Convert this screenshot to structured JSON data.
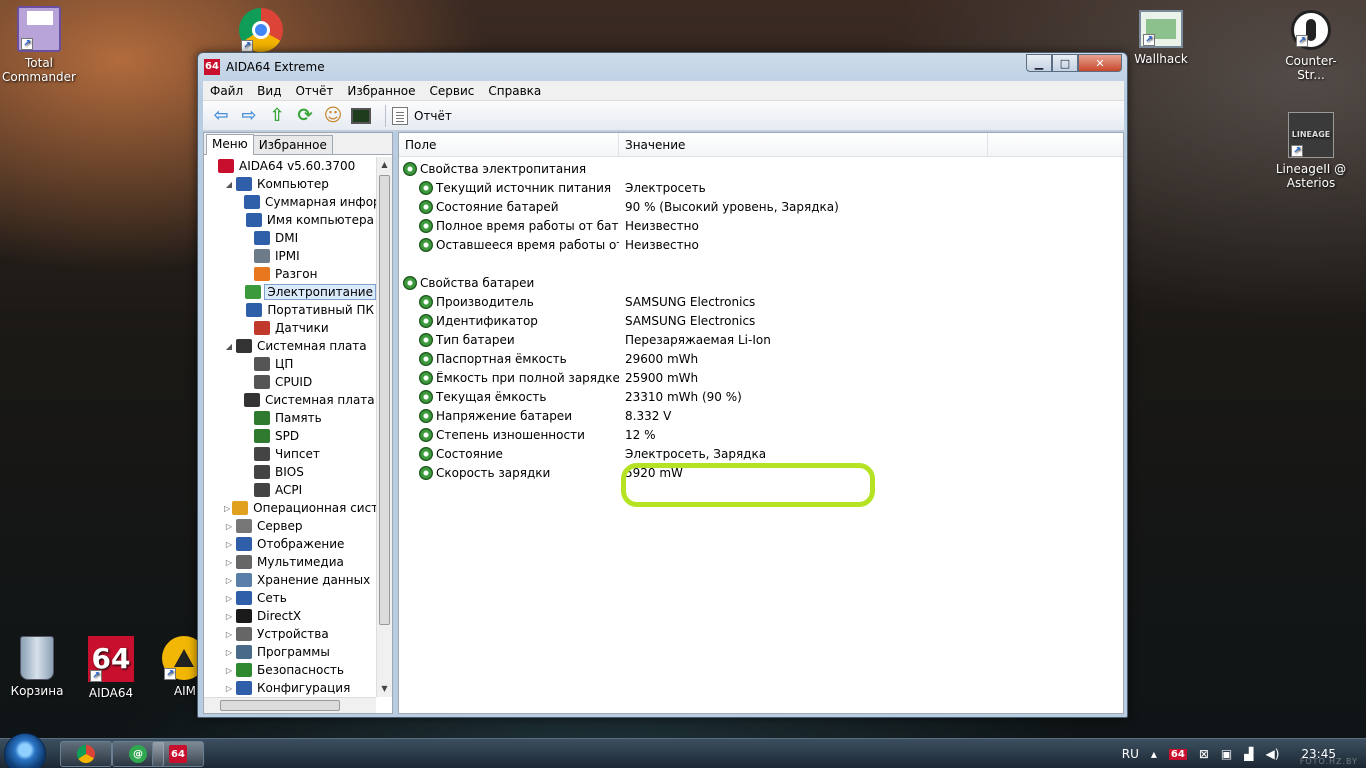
{
  "desktop": {
    "icons": [
      {
        "label": "Total Commander",
        "icon": "floppy-icon"
      },
      {
        "label": "",
        "icon": "chrome-icon"
      },
      {
        "label": "Wallhack",
        "icon": "window-icon"
      },
      {
        "label": "Counter-Str...",
        "icon": "cs-icon"
      },
      {
        "label": "LineageII @ Asterios",
        "icon": "lineage-icon"
      },
      {
        "label": "Корзина",
        "icon": "recycle-bin-icon"
      },
      {
        "label": "AIDA64",
        "icon": "aida64-icon"
      },
      {
        "label": "AIM",
        "icon": "aimp-icon"
      }
    ],
    "aida_logo_text": "64",
    "lineage_logo_text": "LINEAGE"
  },
  "window": {
    "logo": "64",
    "title": "AIDA64 Extreme",
    "min_symbol": "▁",
    "max_symbol": "□",
    "close_symbol": "✕"
  },
  "menu": [
    "Файл",
    "Вид",
    "Отчёт",
    "Избранное",
    "Сервис",
    "Справка"
  ],
  "toolbar": {
    "report_label": "Отчёт",
    "icons": [
      "back-arrow-icon",
      "forward-arrow-icon",
      "up-arrow-icon",
      "refresh-icon",
      "users-icon",
      "monitor-icon"
    ]
  },
  "left_tabs": [
    "Меню",
    "Избранное"
  ],
  "tree": [
    {
      "label": "AIDA64 v5.60.3700",
      "level": 0,
      "exp": "",
      "icon": "aida64-icon",
      "color": "#c8102e"
    },
    {
      "label": "Компьютер",
      "level": 1,
      "exp": "◢",
      "icon": "computer-icon",
      "color": "#2f5fa8"
    },
    {
      "label": "Суммарная инфор",
      "level": 2,
      "exp": "",
      "icon": "computer-icon",
      "color": "#2f5fa8"
    },
    {
      "label": "Имя компьютера",
      "level": 2,
      "exp": "",
      "icon": "computer-icon",
      "color": "#2f5fa8"
    },
    {
      "label": "DMI",
      "level": 2,
      "exp": "",
      "icon": "computer-icon",
      "color": "#2f5fa8"
    },
    {
      "label": "IPMI",
      "level": 2,
      "exp": "",
      "icon": "document-icon",
      "color": "#6c7a8a"
    },
    {
      "label": "Разгон",
      "level": 2,
      "exp": "",
      "icon": "flame-icon",
      "color": "#e8771e"
    },
    {
      "label": "Электропитание",
      "level": 2,
      "exp": "",
      "icon": "power-gear-icon",
      "color": "#3c9a3c",
      "selected": true
    },
    {
      "label": "Портативный ПК",
      "level": 2,
      "exp": "",
      "icon": "laptop-icon",
      "color": "#2f5fa8"
    },
    {
      "label": "Датчики",
      "level": 2,
      "exp": "",
      "icon": "sensor-icon",
      "color": "#c0392b"
    },
    {
      "label": "Системная плата",
      "level": 1,
      "exp": "◢",
      "icon": "motherboard-icon",
      "color": "#333333"
    },
    {
      "label": "ЦП",
      "level": 2,
      "exp": "",
      "icon": "cpu-icon",
      "color": "#555555"
    },
    {
      "label": "CPUID",
      "level": 2,
      "exp": "",
      "icon": "cpu-icon",
      "color": "#555555"
    },
    {
      "label": "Системная плата",
      "level": 2,
      "exp": "",
      "icon": "motherboard-icon",
      "color": "#333333"
    },
    {
      "label": "Память",
      "level": 2,
      "exp": "",
      "icon": "memory-icon",
      "color": "#2f7a2f"
    },
    {
      "label": "SPD",
      "level": 2,
      "exp": "",
      "icon": "memory-icon",
      "color": "#2f7a2f"
    },
    {
      "label": "Чипсет",
      "level": 2,
      "exp": "",
      "icon": "chip-icon",
      "color": "#444444"
    },
    {
      "label": "BIOS",
      "level": 2,
      "exp": "",
      "icon": "chip-icon",
      "color": "#444444"
    },
    {
      "label": "ACPI",
      "level": 2,
      "exp": "",
      "icon": "chip-icon",
      "color": "#444444"
    },
    {
      "label": "Операционная систем",
      "level": 1,
      "exp": "▷",
      "icon": "windows-icon",
      "color": "#e0a020"
    },
    {
      "label": "Сервер",
      "level": 1,
      "exp": "▷",
      "icon": "server-icon",
      "color": "#777777"
    },
    {
      "label": "Отображение",
      "level": 1,
      "exp": "▷",
      "icon": "display-icon",
      "color": "#2f5fa8"
    },
    {
      "label": "Мультимедиа",
      "level": 1,
      "exp": "▷",
      "icon": "multimedia-icon",
      "color": "#666666"
    },
    {
      "label": "Хранение данных",
      "level": 1,
      "exp": "▷",
      "icon": "storage-icon",
      "color": "#5a7fa8"
    },
    {
      "label": "Сеть",
      "level": 1,
      "exp": "▷",
      "icon": "network-icon",
      "color": "#2f5fa8"
    },
    {
      "label": "DirectX",
      "level": 1,
      "exp": "▷",
      "icon": "directx-icon",
      "color": "#1a1a1a"
    },
    {
      "label": "Устройства",
      "level": 1,
      "exp": "▷",
      "icon": "devices-icon",
      "color": "#666666"
    },
    {
      "label": "Программы",
      "level": 1,
      "exp": "▷",
      "icon": "programs-icon",
      "color": "#4a6a8a"
    },
    {
      "label": "Безопасность",
      "level": 1,
      "exp": "▷",
      "icon": "shield-icon",
      "color": "#2f8a2f"
    },
    {
      "label": "Конфигурация",
      "level": 1,
      "exp": "▷",
      "icon": "config-icon",
      "color": "#2f5fa8"
    }
  ],
  "columns": [
    "Поле",
    "Значение"
  ],
  "sections": [
    {
      "title": "Свойства электропитания",
      "rows": [
        {
          "field": "Текущий источник питания",
          "value": "Электросеть"
        },
        {
          "field": "Состояние батарей",
          "value": "90 % (Высокий уровень, Зарядка)"
        },
        {
          "field": "Полное время работы от бата...",
          "value": "Неизвестно"
        },
        {
          "field": "Оставшееся время работы от ...",
          "value": "Неизвестно"
        }
      ]
    },
    {
      "title": "Свойства батареи",
      "rows": [
        {
          "field": "Производитель",
          "value": "SAMSUNG Electronics"
        },
        {
          "field": "Идентификатор",
          "value": "SAMSUNG Electronics"
        },
        {
          "field": "Тип батареи",
          "value": "Перезаряжаемая Li-Ion"
        },
        {
          "field": "Паспортная ёмкость",
          "value": "29600 mWh"
        },
        {
          "field": "Ёмкость при полной зарядке",
          "value": "25900 mWh"
        },
        {
          "field": "Текущая ёмкость",
          "value": "23310 mWh  (90 %)"
        },
        {
          "field": "Напряжение батареи",
          "value": "8.332 V"
        },
        {
          "field": "Степень изношенности",
          "value": "12 %"
        },
        {
          "field": "Состояние",
          "value": "Электросеть, Зарядка"
        },
        {
          "field": "Скорость зарядки",
          "value": "5920 mW"
        }
      ]
    }
  ],
  "highlight_color": "#b5e323",
  "taskbar": {
    "language": "RU",
    "time": "23:45",
    "apps": [
      "chrome-icon",
      "qip-icon",
      "aida64-icon"
    ],
    "aida_text": "64",
    "tray_icons": [
      "arrow-up-icon",
      "aida64-tray-icon",
      "network-icon",
      "power-icon",
      "signal-icon",
      "volume-icon"
    ]
  },
  "watermark": "FOTO.HZ.BY"
}
